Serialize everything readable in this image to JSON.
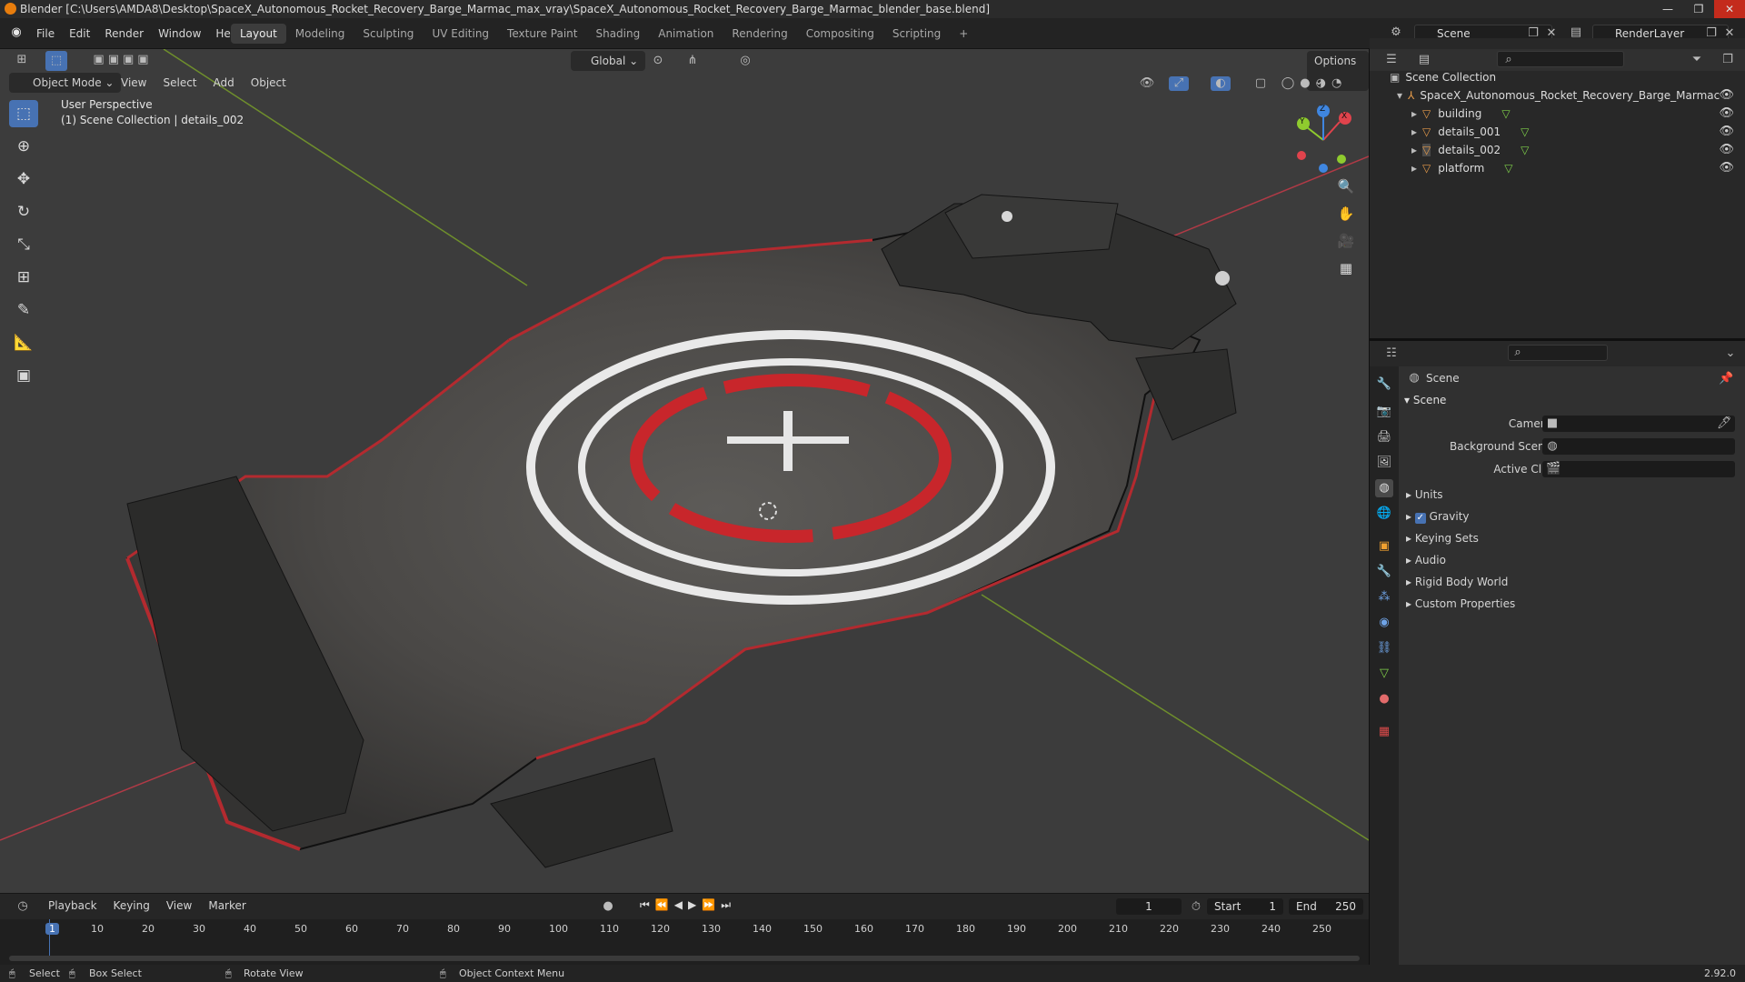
{
  "window": {
    "title": "Blender [C:\\Users\\AMDA8\\Desktop\\SpaceX_Autonomous_Rocket_Recovery_Barge_Marmac_max_vray\\SpaceX_Autonomous_Rocket_Recovery_Barge_Marmac_blender_base.blend]",
    "controls": [
      "—",
      "❐",
      "✕"
    ]
  },
  "menu": [
    "File",
    "Edit",
    "Render",
    "Window",
    "Help"
  ],
  "workspaces": [
    "Layout",
    "Modeling",
    "Sculpting",
    "UV Editing",
    "Texture Paint",
    "Shading",
    "Animation",
    "Rendering",
    "Compositing",
    "Scripting",
    "+"
  ],
  "scene_field": "Scene",
  "renderlayer_field": "RenderLayer",
  "viewport": {
    "transform_orientation": "Global",
    "options_label": "Options",
    "mode": "Object Mode",
    "menus": [
      "View",
      "Select",
      "Add",
      "Object"
    ],
    "perspective_label": "User Perspective",
    "collection_label": "(1) Scene Collection | details_002",
    "gizmo_axes": {
      "x": "X",
      "y": "Y",
      "z": "Z"
    },
    "colors": {
      "x_axis": "#e0434c",
      "y_axis": "#8fcb2e",
      "z_axis": "#3f86e0",
      "deck_ring_red": "#c8262b"
    }
  },
  "outliner": {
    "root": "Scene Collection",
    "collection": "SpaceX_Autonomous_Rocket_Recovery_Barge_Marmac",
    "objects": [
      "building",
      "details_001",
      "details_002",
      "platform"
    ]
  },
  "properties": {
    "header": "Scene",
    "panel": "Scene",
    "fields": [
      {
        "label": "Camera",
        "value": ""
      },
      {
        "label": "Background Scene",
        "value": ""
      },
      {
        "label": "Active Clip",
        "value": ""
      }
    ],
    "subpanels": [
      "Units",
      "Gravity",
      "Keying Sets",
      "Audio",
      "Rigid Body World",
      "Custom Properties"
    ],
    "gravity_checked": true
  },
  "timeline": {
    "menus": [
      "Playback",
      "Keying",
      "View",
      "Marker"
    ],
    "current_frame": "1",
    "start_label": "Start",
    "start_value": "1",
    "end_label": "End",
    "end_value": "250",
    "ticks": [
      "1",
      "10",
      "20",
      "30",
      "40",
      "50",
      "60",
      "70",
      "80",
      "90",
      "100",
      "110",
      "120",
      "130",
      "140",
      "150",
      "160",
      "170",
      "180",
      "190",
      "200",
      "210",
      "220",
      "230",
      "240",
      "250"
    ]
  },
  "status": {
    "select": "Select",
    "box_select": "Box Select",
    "rotate_view": "Rotate View",
    "context_menu": "Object Context Menu",
    "version": "2.92.0"
  }
}
